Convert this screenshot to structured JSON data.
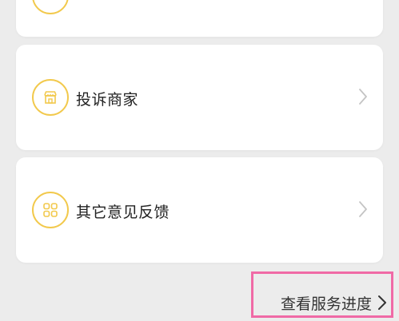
{
  "items": [
    {
      "label": "投诉商家",
      "icon": "store-icon"
    },
    {
      "label": "其它意见反馈",
      "icon": "grid-icon"
    }
  ],
  "footer": {
    "progress_label": "查看服务进度"
  },
  "colors": {
    "accent": "#f2c94c",
    "highlight": "#f06aa6",
    "background": "#ececec"
  }
}
